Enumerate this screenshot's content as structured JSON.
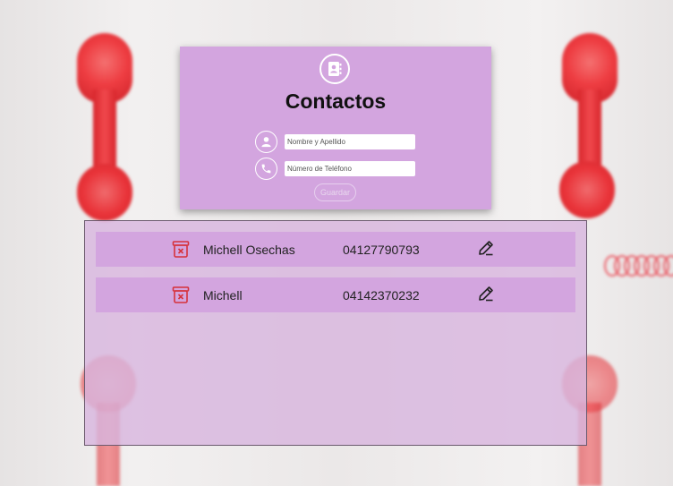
{
  "form": {
    "title": "Contactos",
    "name_placeholder": "Nombre y Apellido",
    "phone_placeholder": "Número de Teléfono",
    "save_label": "Guardar"
  },
  "contacts": [
    {
      "name": "Michell Osechas",
      "phone": "04127790793"
    },
    {
      "name": "Michell",
      "phone": "04142370232"
    }
  ],
  "icons": {
    "logo": "contact-book-icon",
    "name_field": "user-icon",
    "phone_field": "phone-icon",
    "delete": "trash-icon",
    "edit": "pencil-icon"
  },
  "colors": {
    "card_bg": "#d3a5df",
    "panel_bg": "#d8b6de",
    "delete_icon": "#d6323c",
    "phone_red": "#ee3d42"
  }
}
